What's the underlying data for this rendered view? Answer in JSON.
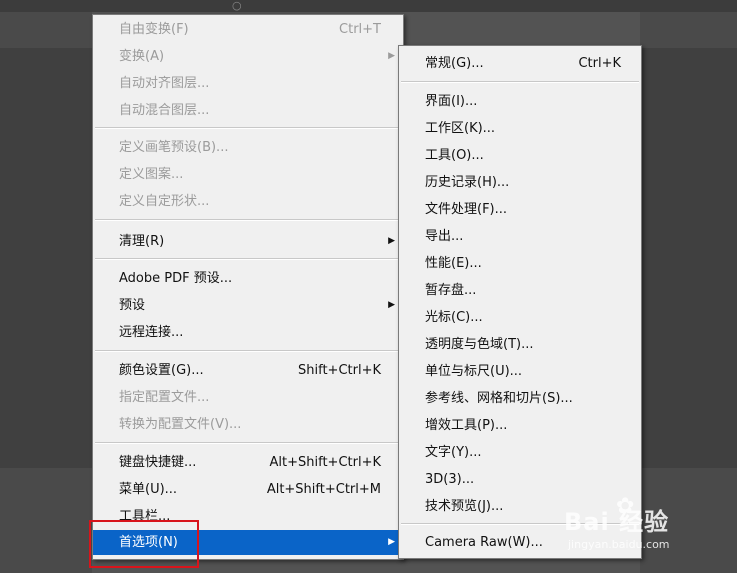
{
  "main_menu": {
    "items": [
      {
        "label": "自由变换(F)",
        "shortcut": "Ctrl+T"
      },
      {
        "label": "变换(A)"
      },
      {
        "label": "自动对齐图层..."
      },
      {
        "label": "自动混合图层..."
      },
      {
        "label": "定义画笔预设(B)..."
      },
      {
        "label": "定义图案..."
      },
      {
        "label": "定义自定形状..."
      },
      {
        "label": "清理(R)"
      },
      {
        "label": "Adobe PDF 预设..."
      },
      {
        "label": "预设"
      },
      {
        "label": "远程连接..."
      },
      {
        "label": "颜色设置(G)...",
        "shortcut": "Shift+Ctrl+K"
      },
      {
        "label": "指定配置文件..."
      },
      {
        "label": "转换为配置文件(V)..."
      },
      {
        "label": "键盘快捷键...",
        "shortcut": "Alt+Shift+Ctrl+K"
      },
      {
        "label": "菜单(U)...",
        "shortcut": "Alt+Shift+Ctrl+M"
      },
      {
        "label": "工具栏..."
      },
      {
        "label": "首选项(N)"
      }
    ]
  },
  "submenu": {
    "items": [
      {
        "label": "常规(G)...",
        "shortcut": "Ctrl+K"
      },
      {
        "label": "界面(I)..."
      },
      {
        "label": "工作区(K)..."
      },
      {
        "label": "工具(O)..."
      },
      {
        "label": "历史记录(H)..."
      },
      {
        "label": "文件处理(F)..."
      },
      {
        "label": "导出..."
      },
      {
        "label": "性能(E)..."
      },
      {
        "label": "暂存盘..."
      },
      {
        "label": "光标(C)..."
      },
      {
        "label": "透明度与色域(T)..."
      },
      {
        "label": "单位与标尺(U)..."
      },
      {
        "label": "参考线、网格和切片(S)..."
      },
      {
        "label": "增效工具(P)..."
      },
      {
        "label": "文字(Y)..."
      },
      {
        "label": "3D(3)..."
      },
      {
        "label": "技术预览(J)..."
      },
      {
        "label": "Camera Raw(W)..."
      }
    ]
  },
  "watermark": {
    "brand": "Bai  经验",
    "url": "jingyan.baidu.com"
  },
  "colors": {
    "selected_bg": "#0a64c8",
    "highlight_border": "#d8141b",
    "menu_bg": "#f0f0f0"
  }
}
